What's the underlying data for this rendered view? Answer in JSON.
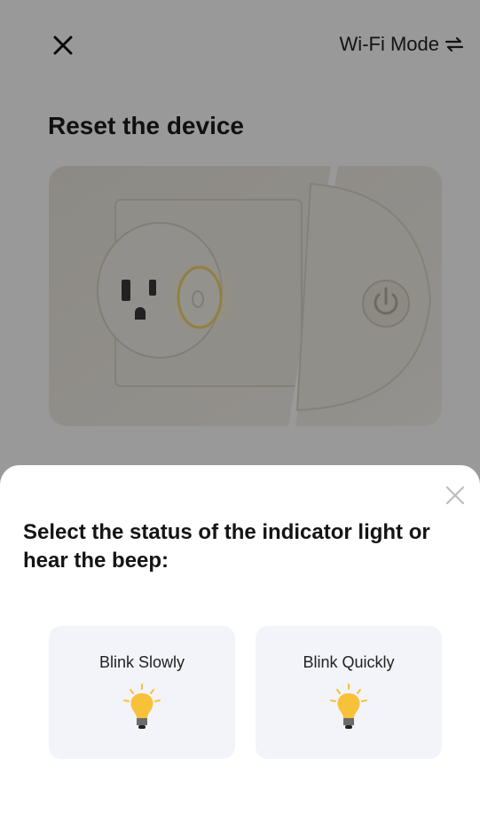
{
  "header": {
    "close_icon": "close-icon",
    "mode_label": "Wi-Fi Mode",
    "mode_icon": "swap-icon"
  },
  "page": {
    "title": "Reset the device"
  },
  "sheet": {
    "close_icon": "close-icon",
    "title": "Select the status of the indicator light or hear the beep:",
    "options": [
      {
        "label": "Blink Slowly",
        "icon": "light-bulb-icon"
      },
      {
        "label": "Blink Quickly",
        "icon": "light-bulb-icon"
      }
    ]
  },
  "colors": {
    "bulb": "#f7c13a",
    "option_bg": "#f3f4f9",
    "overlay": "rgba(0,0,0,0.40)"
  }
}
